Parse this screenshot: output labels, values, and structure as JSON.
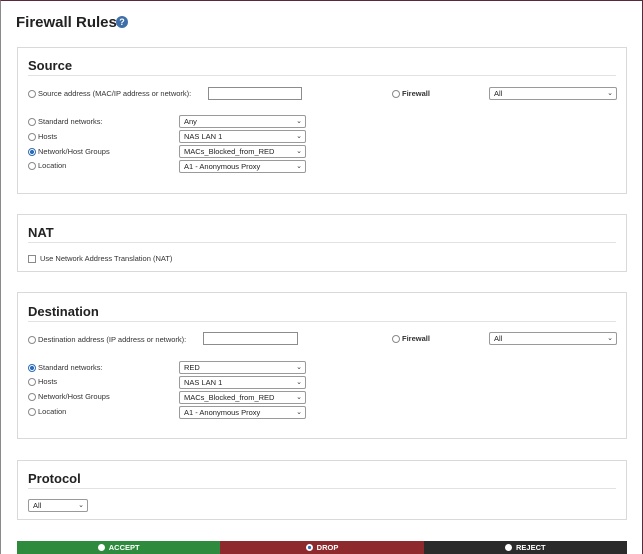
{
  "page": {
    "title": "Firewall Rules",
    "help_icon": "question-circle-icon"
  },
  "source": {
    "title": "Source",
    "address_label": "Source address (MAC/IP address or network):",
    "address_value": "",
    "firewall_label": "Firewall",
    "firewall_select": "All",
    "rows": [
      {
        "label": "Standard networks:",
        "value": "Any",
        "selected": false
      },
      {
        "label": "Hosts",
        "value": "NAS LAN 1",
        "selected": false
      },
      {
        "label": "Network/Host Groups",
        "value": "MACs_Blocked_from_RED",
        "selected": true
      },
      {
        "label": "Location",
        "value": "A1 - Anonymous Proxy",
        "selected": false
      }
    ]
  },
  "nat": {
    "title": "NAT",
    "checkbox_label": "Use Network Address Translation (NAT)",
    "checked": false
  },
  "destination": {
    "title": "Destination",
    "address_label": "Destination address (IP address or network):",
    "address_value": "",
    "firewall_label": "Firewall",
    "firewall_select": "All",
    "rows": [
      {
        "label": "Standard networks:",
        "value": "RED",
        "selected": true
      },
      {
        "label": "Hosts",
        "value": "NAS LAN 1",
        "selected": false
      },
      {
        "label": "Network/Host Groups",
        "value": "MACs_Blocked_from_RED",
        "selected": false
      },
      {
        "label": "Location",
        "value": "A1 - Anonymous Proxy",
        "selected": false
      }
    ]
  },
  "protocol": {
    "title": "Protocol",
    "select": "All"
  },
  "actions": {
    "accept": {
      "label": "ACCEPT",
      "color": "#2e8b3e",
      "selected": false
    },
    "drop": {
      "label": "DROP",
      "color": "#8e2a2d",
      "selected": true
    },
    "reject": {
      "label": "REJECT",
      "color": "#2b2b2b",
      "selected": false
    }
  }
}
